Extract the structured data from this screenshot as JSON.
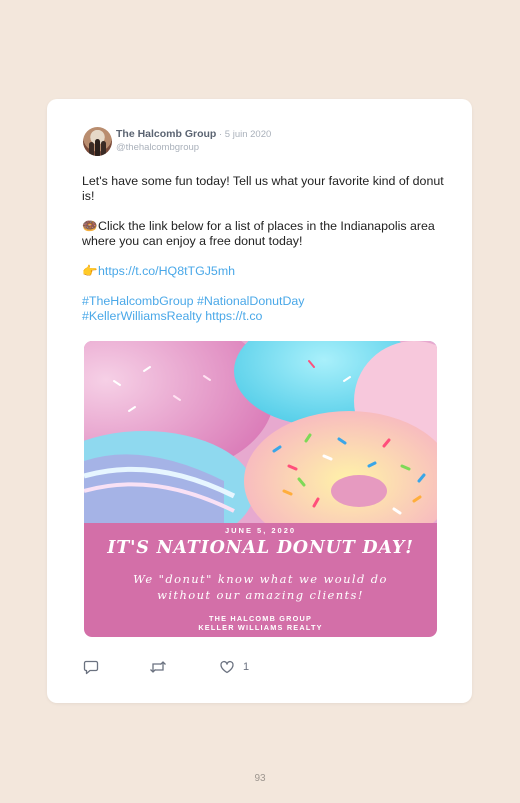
{
  "tweet": {
    "author": "The Halcomb Group",
    "date": " · 5 juin 2020",
    "handle": "@thehalcombgroup",
    "line1": "Let's have some fun today! Tell us what your favorite kind of donut is!",
    "line2_emoji": "🍩",
    "line2": "Click the link below for a list of places in the Indianapolis area where you can enjoy a free donut today!",
    "line3_emoji": "👉",
    "link1": "https://t.co/HQ8tTGJ5mh",
    "hashtag1": "#TheHalcombGroup",
    "hashtag2": "#NationalDonutDay",
    "hashtag3": "#KellerWilliamsRealty",
    "link2": "https://t.co"
  },
  "media": {
    "date": "JUNE 5, 2020",
    "title": "IT'S NATIONAL DONUT DAY!",
    "subtitle_line1": "We \"donut\" know what we would do",
    "subtitle_line2": "without our amazing clients!",
    "footer_line1": "THE HALCOMB GROUP",
    "footer_line2": "KELLER WILLIAMS REALTY"
  },
  "actions": {
    "reply_icon": "reply-icon",
    "retweet_icon": "retweet-icon",
    "like_icon": "heart-icon",
    "like_count": "1"
  },
  "page_number": "93"
}
